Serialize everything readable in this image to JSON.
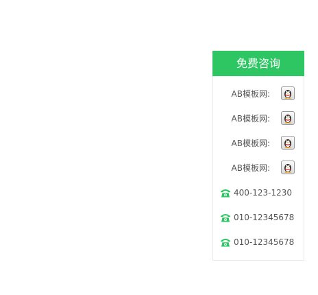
{
  "panel": {
    "title": "免费咨询",
    "qq_contacts": [
      {
        "label": "AB模板网:",
        "icon": "qq-penguin-icon"
      },
      {
        "label": "AB模板网:",
        "icon": "qq-penguin-icon"
      },
      {
        "label": "AB模板网:",
        "icon": "qq-penguin-icon"
      },
      {
        "label": "AB模板网:",
        "icon": "qq-penguin-icon"
      }
    ],
    "phones": [
      {
        "number": "400-123-1230",
        "icon": "phone-icon"
      },
      {
        "number": "010-12345678",
        "icon": "phone-icon"
      },
      {
        "number": "010-12345678",
        "icon": "phone-icon"
      }
    ]
  },
  "colors": {
    "accent": "#2dc663",
    "text": "#555555",
    "border": "#e8e8e8"
  }
}
